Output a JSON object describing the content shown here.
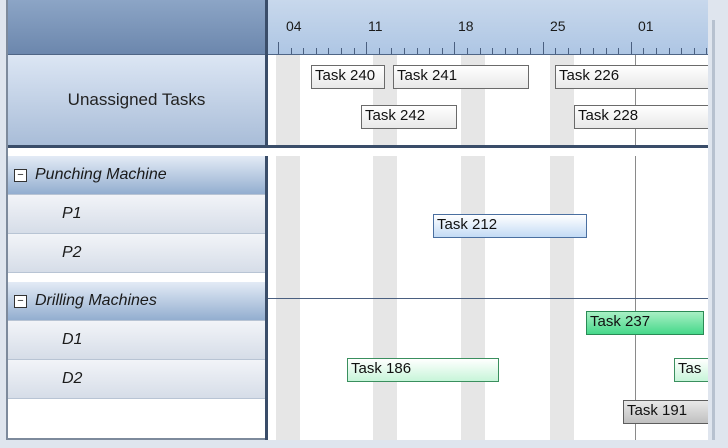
{
  "unassigned": {
    "label": "Unassigned Tasks"
  },
  "timeline": {
    "dates": [
      "04",
      "11",
      "18",
      "25",
      "01"
    ]
  },
  "unassigned_tasks": [
    {
      "label": "Task 240"
    },
    {
      "label": "Task 241"
    },
    {
      "label": "Task 226"
    },
    {
      "label": "Task 242"
    },
    {
      "label": "Task 228"
    }
  ],
  "resources": [
    {
      "label": "Punching Machine",
      "type": "group",
      "toggle": "−"
    },
    {
      "label": "P1",
      "type": "leaf"
    },
    {
      "label": "P2",
      "type": "leaf"
    },
    {
      "label": "Drilling Machines",
      "type": "group",
      "toggle": "−"
    },
    {
      "label": "D1",
      "type": "leaf"
    },
    {
      "label": "D2",
      "type": "leaf"
    }
  ],
  "scheduled_tasks": [
    {
      "label": "Task 212",
      "style": "blue"
    },
    {
      "label": "Task 237",
      "style": "green"
    },
    {
      "label": "Task 186",
      "style": "lightgreen"
    },
    {
      "label": "Task 191",
      "style": "gray"
    },
    {
      "label": "Tas",
      "style": "lightgreen"
    }
  ],
  "colors": {
    "header_blue": "#8ca5c6",
    "separator": "#3a4d69",
    "task_selected_green": "#46d88a",
    "task_blue": "#c3dbf5"
  }
}
